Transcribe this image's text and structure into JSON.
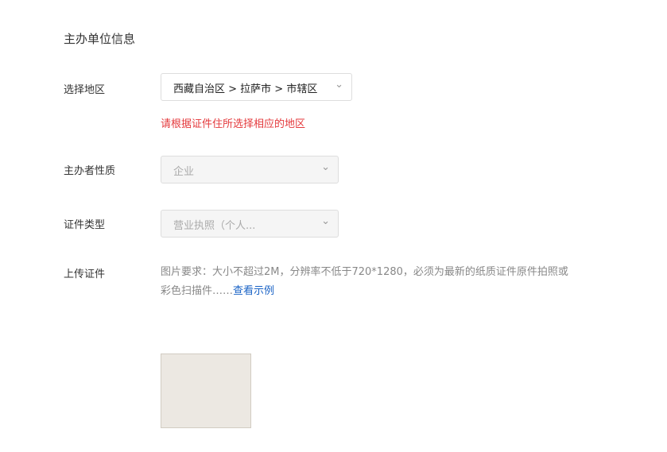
{
  "title": "主办单位信息",
  "region_label": "选择地区",
  "region": "西藏自治区 > 拉萨市 > 市辖区",
  "tip": "请根据证件住所选择相应的地区",
  "host_label": "主办者性质",
  "host": "企业",
  "cert_label": "证件类型",
  "cert": "营业执照（个人...",
  "upload_label": "上传证件",
  "req": "图片要求：大小不超过2M，分辨率不低于720*1280，必须为最新的纸质证件原件拍照或彩色扫描件……",
  "example": "查看示例"
}
